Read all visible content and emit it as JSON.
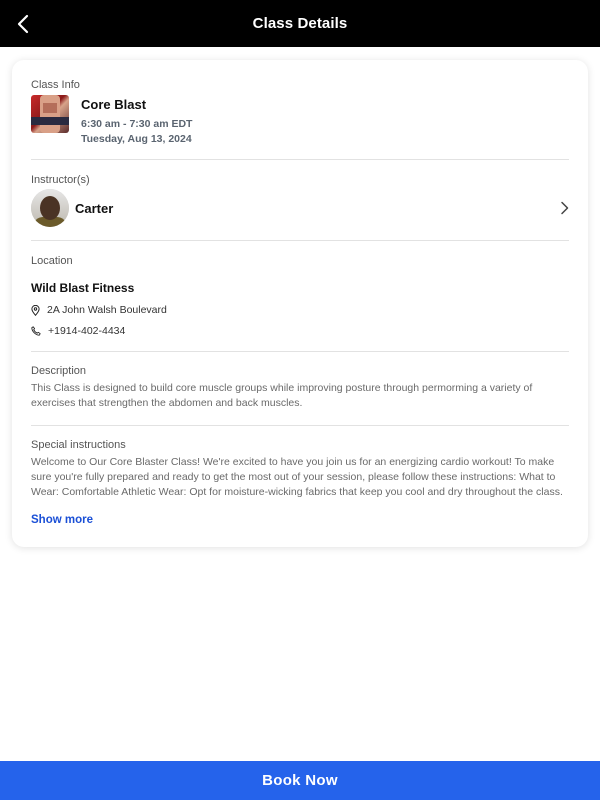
{
  "header": {
    "title": "Class Details",
    "back_icon": "chevron-left-icon"
  },
  "class_info": {
    "label": "Class Info",
    "name": "Core Blast",
    "time": "6:30 am - 7:30 am EDT",
    "date": "Tuesday, Aug 13, 2024"
  },
  "instructor": {
    "label": "Instructor(s)",
    "name": "Carter"
  },
  "location": {
    "label": "Location",
    "name": "Wild Blast Fitness",
    "address": "2A John Walsh Boulevard",
    "phone": "+1914-402-4434"
  },
  "description": {
    "label": "Description",
    "text": "This Class  is designed to build core muscle groups while improving posture through permorming a variety of exercises that strengthen the abdomen and back muscles."
  },
  "special_instructions": {
    "label": "Special instructions",
    "text": "Welcome to Our Core Blaster Class! We're excited to have you join us for an energizing cardio workout! To make sure you're fully prepared and ready to get the most out of your session, please follow these instructions: What to Wear: Comfortable Athletic Wear: Opt for moisture-wicking fabrics that keep you cool and dry throughout the class.",
    "show_more": "Show more"
  },
  "footer": {
    "book_label": "Book Now"
  },
  "colors": {
    "accent": "#2563eb",
    "link": "#1a4fd6",
    "header_bg": "#000000"
  }
}
